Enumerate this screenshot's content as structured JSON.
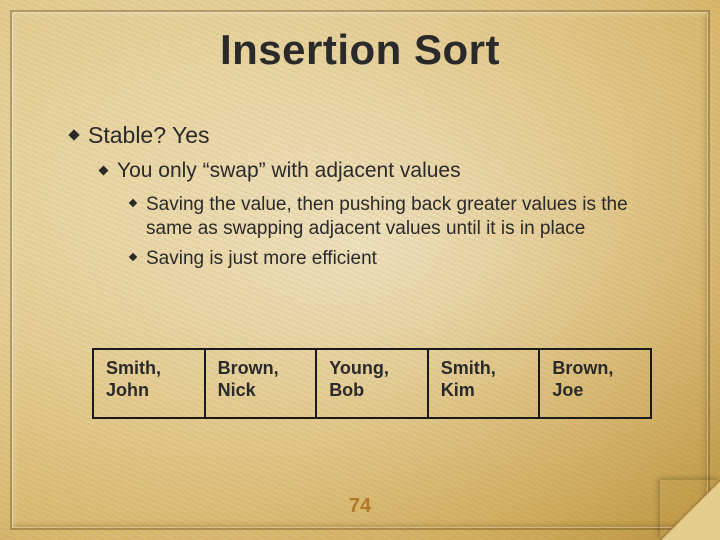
{
  "title": "Insertion Sort",
  "bullets": {
    "l1": "Stable?  Yes",
    "l2": "You only “swap” with adjacent values",
    "l3a": "Saving the value, then pushing back greater values is the same as swapping adjacent values until it is in place",
    "l3b": "Saving is just more efficient"
  },
  "names": [
    "Smith, John",
    "Brown, Nick",
    "Young, Bob",
    "Smith, Kim",
    "Brown, Joe"
  ],
  "page_number": "74"
}
